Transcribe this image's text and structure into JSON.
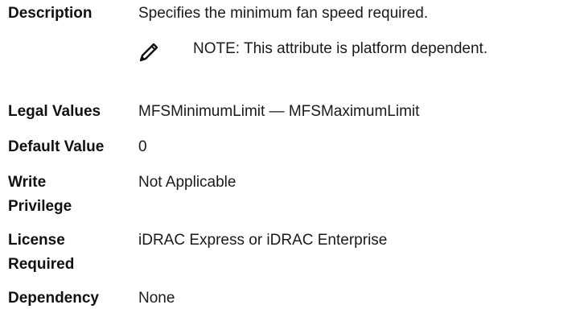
{
  "rows": {
    "description": {
      "label": "Description",
      "value": "Specifies the minimum fan speed required.",
      "note": {
        "icon": "pencil-icon",
        "prefix": "NOTE:",
        "text": " This attribute is platform dependent."
      }
    },
    "legal_values": {
      "label": "Legal Values",
      "value": "MFSMinimumLimit — MFSMaximumLimit"
    },
    "default_value": {
      "label": "Default Value",
      "value": "0"
    },
    "write_privilege": {
      "label_line1": "Write",
      "label_line2": "Privilege",
      "value": "Not Applicable"
    },
    "license_required": {
      "label_line1": "License",
      "label_line2": "Required",
      "value": "iDRAC Express or iDRAC Enterprise"
    },
    "dependency": {
      "label": "Dependency",
      "value": "None"
    }
  }
}
